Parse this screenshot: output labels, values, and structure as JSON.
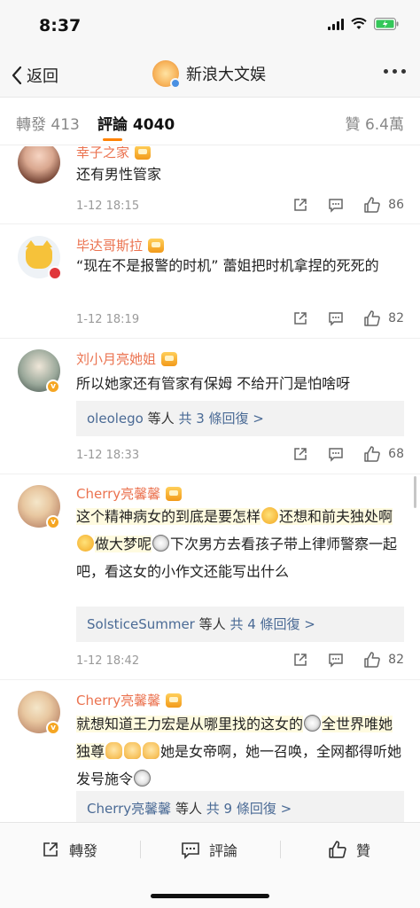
{
  "status": {
    "time": "8:37"
  },
  "nav": {
    "back_label": "返回",
    "title": "新浪大文娱"
  },
  "tabs": {
    "repost_label": "轉發",
    "repost_count": "413",
    "comment_label": "評論",
    "comment_count": "4040",
    "like_label": "贊",
    "like_count": "6.4萬"
  },
  "colors": {
    "accent": "#ff8200",
    "username": "#eb7350",
    "reply_link": "#4a6a95"
  },
  "comments": [
    {
      "name": "幸子之家",
      "text": "还有男性管家",
      "time": "1-12 18:15",
      "likes": "86",
      "replies_user": "",
      "replies_count": ""
    },
    {
      "name": "毕达哥斯拉",
      "text": "“现在不是报警的时机” 蕾姐把时机拿捏的死死的",
      "time": "1-12 18:19",
      "likes": "82",
      "replies_user": "",
      "replies_count": ""
    },
    {
      "name": "刘小月亮她姐",
      "text": "所以她家还有管家有保姆 不给开门是怕啥呀",
      "time": "1-12 18:33",
      "likes": "68",
      "replies_user": "oleolego",
      "replies_mid": "等人",
      "replies_count": "共 3 條回復 >"
    },
    {
      "name": "Cherry亮馨馨",
      "text_a": "这个精神病女的到底是要怎样",
      "text_b": "还想和前夫独处啊",
      "text_c": "做大梦呢",
      "text_d": "下次男方去看孩子带上律师警察一起吧，看这女的小作文还能写出什么",
      "time": "1-12 18:42",
      "likes": "82",
      "replies_user": "SolsticeSummer",
      "replies_mid": "等人",
      "replies_count": "共 4 條回復 >"
    },
    {
      "name": "Cherry亮馨馨",
      "text_a": "就想知道王力宏是从哪里找的这女的",
      "text_b": "全世界唯她独尊",
      "text_c": "她是女帝啊，她一召唤，全网都得听她发号施令",
      "replies_user": "Cherry亮馨馨",
      "replies_mid": "等人",
      "replies_count": "共 9 條回復 >"
    }
  ],
  "bottom": {
    "repost_label": "轉發",
    "comment_label": "評論",
    "like_label": "贊"
  },
  "icons": [
    "chevron-left-icon",
    "more-icon",
    "share-icon",
    "comment-icon",
    "thumb-up-icon",
    "crown-icon",
    "verified-icon"
  ]
}
